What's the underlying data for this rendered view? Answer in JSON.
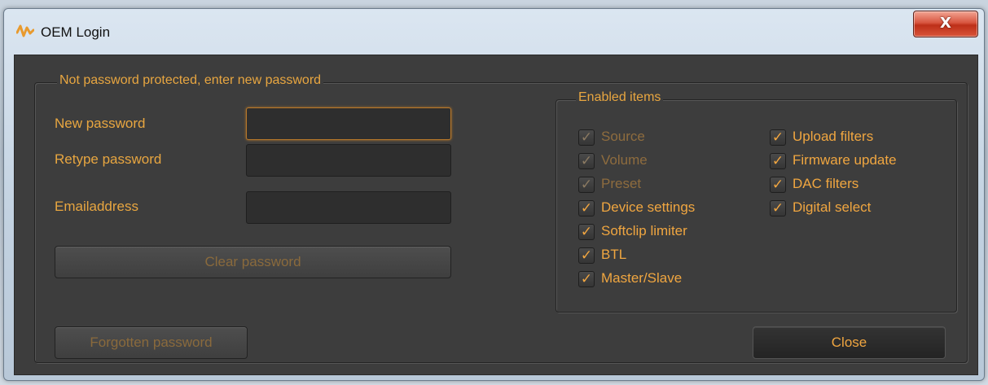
{
  "window": {
    "title": "OEM Login",
    "close_glyph": "X",
    "icon": "waveform-app-icon"
  },
  "password_group": {
    "legend": "Not password protected, enter new password",
    "new_password_label": "New password",
    "new_password_value": "",
    "retype_password_label": "Retype password",
    "retype_password_value": "",
    "email_label": "Emailaddress",
    "email_value": "",
    "clear_button": "Clear password"
  },
  "forgotten_button": "Forgotten password",
  "close_button": "Close",
  "enabled_items": {
    "legend": "Enabled items",
    "left_column": [
      {
        "label": "Source",
        "checked": true,
        "enabled": false
      },
      {
        "label": "Volume",
        "checked": true,
        "enabled": false
      },
      {
        "label": "Preset",
        "checked": true,
        "enabled": false
      },
      {
        "label": "Device settings",
        "checked": true,
        "enabled": true
      },
      {
        "label": "Softclip limiter",
        "checked": true,
        "enabled": true
      },
      {
        "label": "BTL",
        "checked": true,
        "enabled": true
      },
      {
        "label": "Master/Slave",
        "checked": true,
        "enabled": true
      }
    ],
    "right_column": [
      {
        "label": "Upload filters",
        "checked": true,
        "enabled": true
      },
      {
        "label": "Firmware update",
        "checked": true,
        "enabled": true
      },
      {
        "label": "DAC filters",
        "checked": true,
        "enabled": true
      },
      {
        "label": "Digital select",
        "checked": true,
        "enabled": true
      }
    ],
    "check_glyph": "✓"
  },
  "colors": {
    "accent_orange": "#e8a640",
    "dialog_background": "#3d3d3d",
    "disabled_text": "#8e6c3e"
  }
}
